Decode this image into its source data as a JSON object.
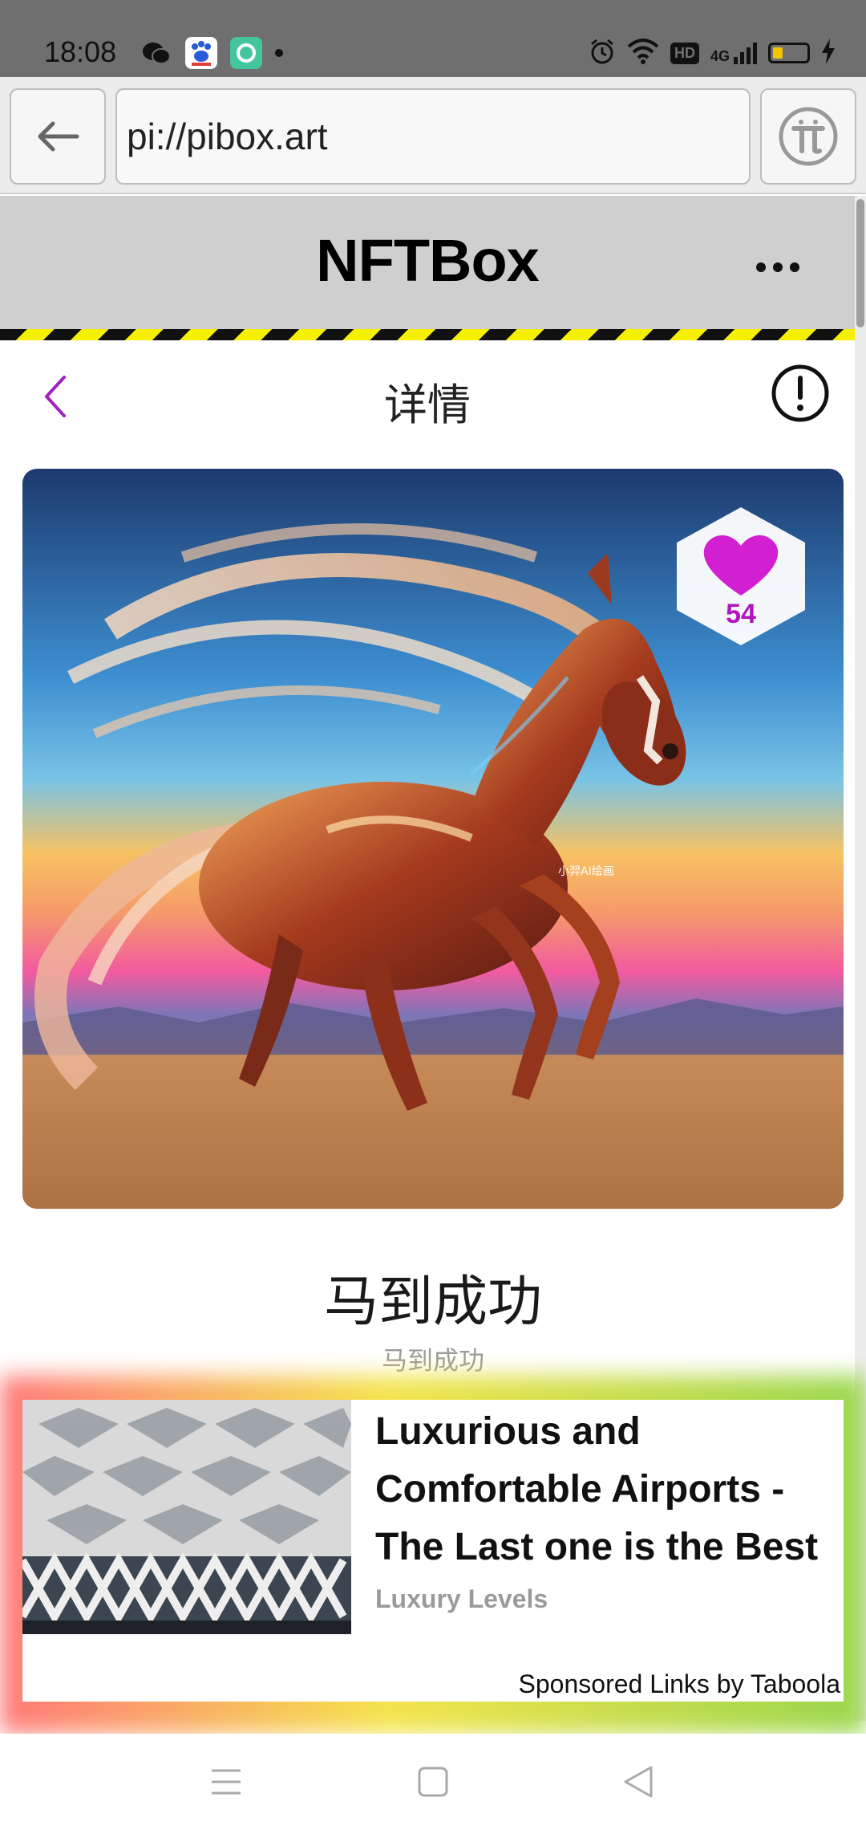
{
  "status_bar": {
    "time": "18:08",
    "network": "4G",
    "hd_label": "HD",
    "battery_level": 0.3
  },
  "browser": {
    "url": "pi://pibox.art"
  },
  "app": {
    "title": "NFTBox"
  },
  "detail": {
    "title": "详情"
  },
  "artwork": {
    "like_count": "54",
    "watermark": "小羿AI绘画"
  },
  "nft": {
    "name": "马到成功",
    "description": "马到成功"
  },
  "ad": {
    "headline": "Luxurious and Comfortable Airports - The Last one is the Best",
    "source": "Luxury Levels",
    "sponsor": "Sponsored Links by Taboola"
  },
  "colors": {
    "accent": "#a020c0",
    "header_bg": "#cfcfcf",
    "status_bg": "#6f6f6f",
    "hazard_yellow": "#f5f000"
  }
}
